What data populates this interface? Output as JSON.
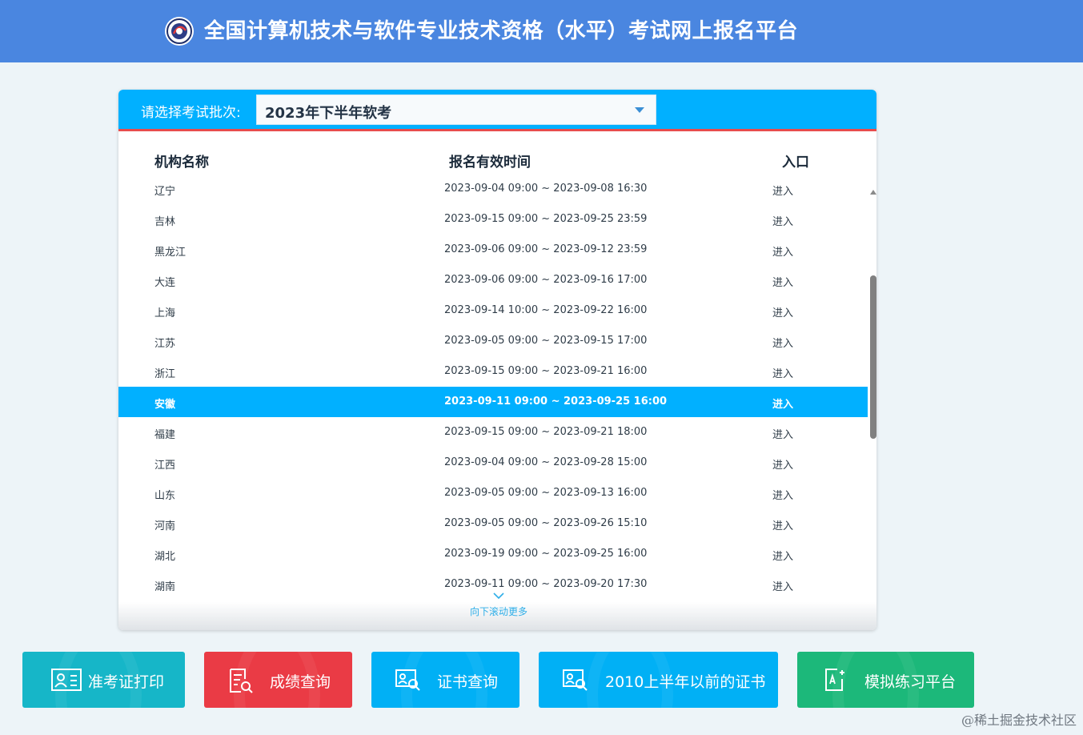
{
  "header": {
    "title": "全国计算机技术与软件专业技术资格（水平）考试网上报名平台"
  },
  "selector": {
    "label": "请选择考试批次:",
    "value": "2023年下半年软考"
  },
  "table": {
    "headers": [
      "机构名称",
      "报名有效时间",
      "入口"
    ],
    "rows": [
      {
        "name": "辽宁",
        "time": "2023-09-04 09:00 ~ 2023-09-08 16:30",
        "entry": "进入"
      },
      {
        "name": "吉林",
        "time": "2023-09-15 09:00 ~ 2023-09-25 23:59",
        "entry": "进入"
      },
      {
        "name": "黑龙江",
        "time": "2023-09-06 09:00 ~ 2023-09-12 23:59",
        "entry": "进入"
      },
      {
        "name": "大连",
        "time": "2023-09-06 09:00 ~ 2023-09-16 17:00",
        "entry": "进入"
      },
      {
        "name": "上海",
        "time": "2023-09-14 10:00 ~ 2023-09-22 16:00",
        "entry": "进入"
      },
      {
        "name": "江苏",
        "time": "2023-09-05 09:00 ~ 2023-09-15 17:00",
        "entry": "进入"
      },
      {
        "name": "浙江",
        "time": "2023-09-15 09:00 ~ 2023-09-21 16:00",
        "entry": "进入"
      },
      {
        "name": "安徽",
        "time": "2023-09-11 09:00 ~ 2023-09-25 16:00",
        "entry": "进入"
      },
      {
        "name": "福建",
        "time": "2023-09-15 09:00 ~ 2023-09-21 18:00",
        "entry": "进入"
      },
      {
        "name": "江西",
        "time": "2023-09-04 09:00 ~ 2023-09-28 15:00",
        "entry": "进入"
      },
      {
        "name": "山东",
        "time": "2023-09-05 09:00 ~ 2023-09-13 16:00",
        "entry": "进入"
      },
      {
        "name": "河南",
        "time": "2023-09-05 09:00 ~ 2023-09-26 15:10",
        "entry": "进入"
      },
      {
        "name": "湖北",
        "time": "2023-09-19 09:00 ~ 2023-09-25 16:00",
        "entry": "进入"
      },
      {
        "name": "湖南",
        "time": "2023-09-11 09:00 ~ 2023-09-20 17:30",
        "entry": "进入"
      }
    ],
    "highlighted_row": "安徽",
    "scroll_hint": "向下滚动更多"
  },
  "buttons": [
    {
      "label": "准考证打印",
      "color": "#16b6c8",
      "icon": "id-card-icon"
    },
    {
      "label": "成绩查询",
      "color": "#ea3b45",
      "icon": "report-search-icon"
    },
    {
      "label": "证书查询",
      "color": "#01b0f5",
      "icon": "certificate-search-icon"
    },
    {
      "label": "2010上半年以前的证书",
      "color": "#01b0f5",
      "icon": "certificate-search-icon"
    },
    {
      "label": "模拟练习平台",
      "color": "#1cb87a",
      "icon": "practice-edit-icon"
    }
  ],
  "watermark": "@稀土掘金技术社区"
}
